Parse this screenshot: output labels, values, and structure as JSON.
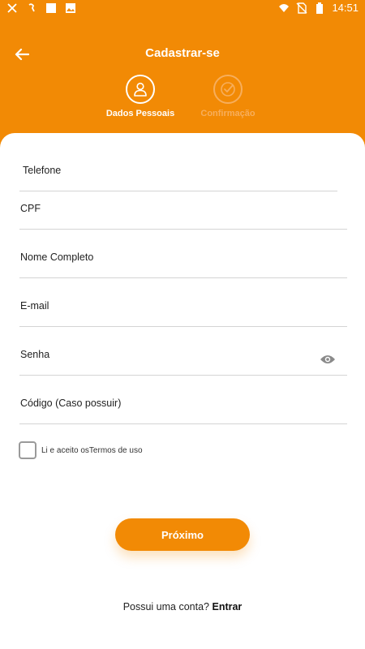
{
  "status_bar": {
    "time": "14:51",
    "icons_left": [
      "xiaomi-icon",
      "headset-icon",
      "square-icon",
      "image-icon"
    ],
    "icons_right": [
      "wifi-icon",
      "no-sim-icon",
      "battery-icon"
    ]
  },
  "header": {
    "title": "Cadastrar-se",
    "steps": [
      {
        "label": "Dados Pessoais",
        "icon": "user-icon",
        "state": "active"
      },
      {
        "label": "Confirmação",
        "icon": "check-circle-icon",
        "state": "inactive"
      }
    ]
  },
  "form": {
    "fields": [
      {
        "label": "Telefone"
      },
      {
        "label": "CPF"
      },
      {
        "label": "Nome Completo"
      },
      {
        "label": "E-mail"
      },
      {
        "label": "Senha",
        "icon": "eye-icon"
      },
      {
        "label": "Código (Caso possuir)"
      }
    ],
    "terms_text": "Li e aceito osTermos de uso",
    "next_button": "Próximo"
  },
  "footer": {
    "question": "Possui uma conta?",
    "login_link": "Entrar"
  },
  "colors": {
    "accent": "#f28a05",
    "inactive_step": "#f7ae5c"
  }
}
